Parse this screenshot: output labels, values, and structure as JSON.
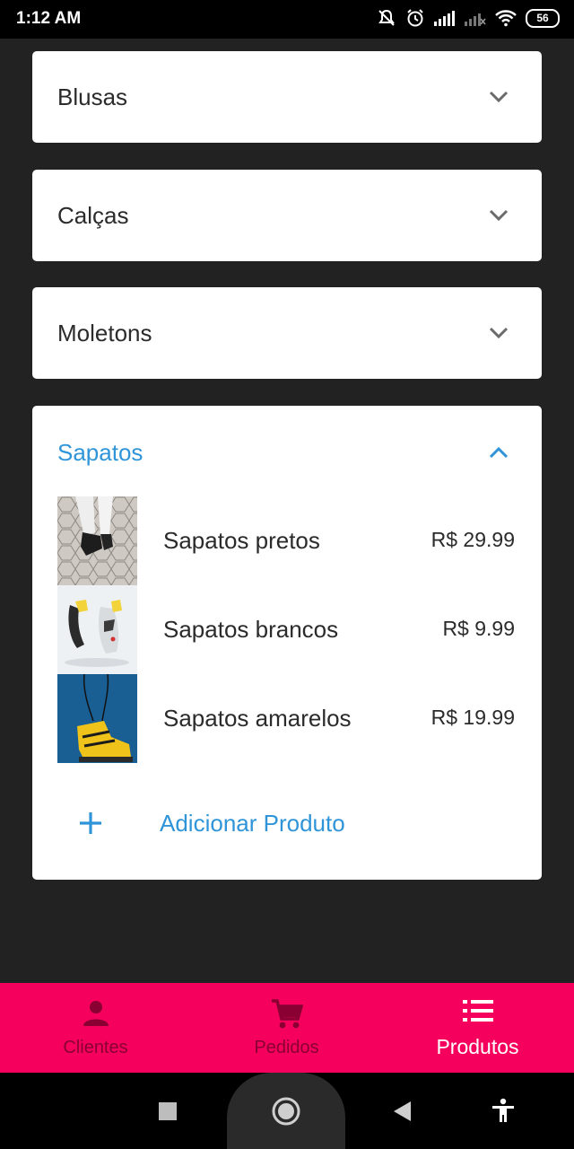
{
  "status": {
    "time": "1:12 AM",
    "battery": "56"
  },
  "categories": [
    {
      "label": "Blusas",
      "expanded": false
    },
    {
      "label": "Calças",
      "expanded": false
    },
    {
      "label": "Moletons",
      "expanded": false
    },
    {
      "label": "Sapatos",
      "expanded": true
    }
  ],
  "products": [
    {
      "name": "Sapatos pretos",
      "price": "R$ 29.99"
    },
    {
      "name": "Sapatos brancos",
      "price": "R$ 9.99"
    },
    {
      "name": "Sapatos amarelos",
      "price": "R$ 19.99"
    }
  ],
  "add_product_label": "Adicionar Produto",
  "bottom_nav": {
    "items": [
      {
        "label": "Clientes",
        "icon": "person-icon",
        "active": false
      },
      {
        "label": "Pedidos",
        "icon": "cart-icon",
        "active": false
      },
      {
        "label": "Produtos",
        "icon": "list-icon",
        "active": true
      }
    ]
  },
  "colors": {
    "accent": "#2f95d8",
    "nav_background": "#f5005c",
    "page_background": "#222222"
  }
}
